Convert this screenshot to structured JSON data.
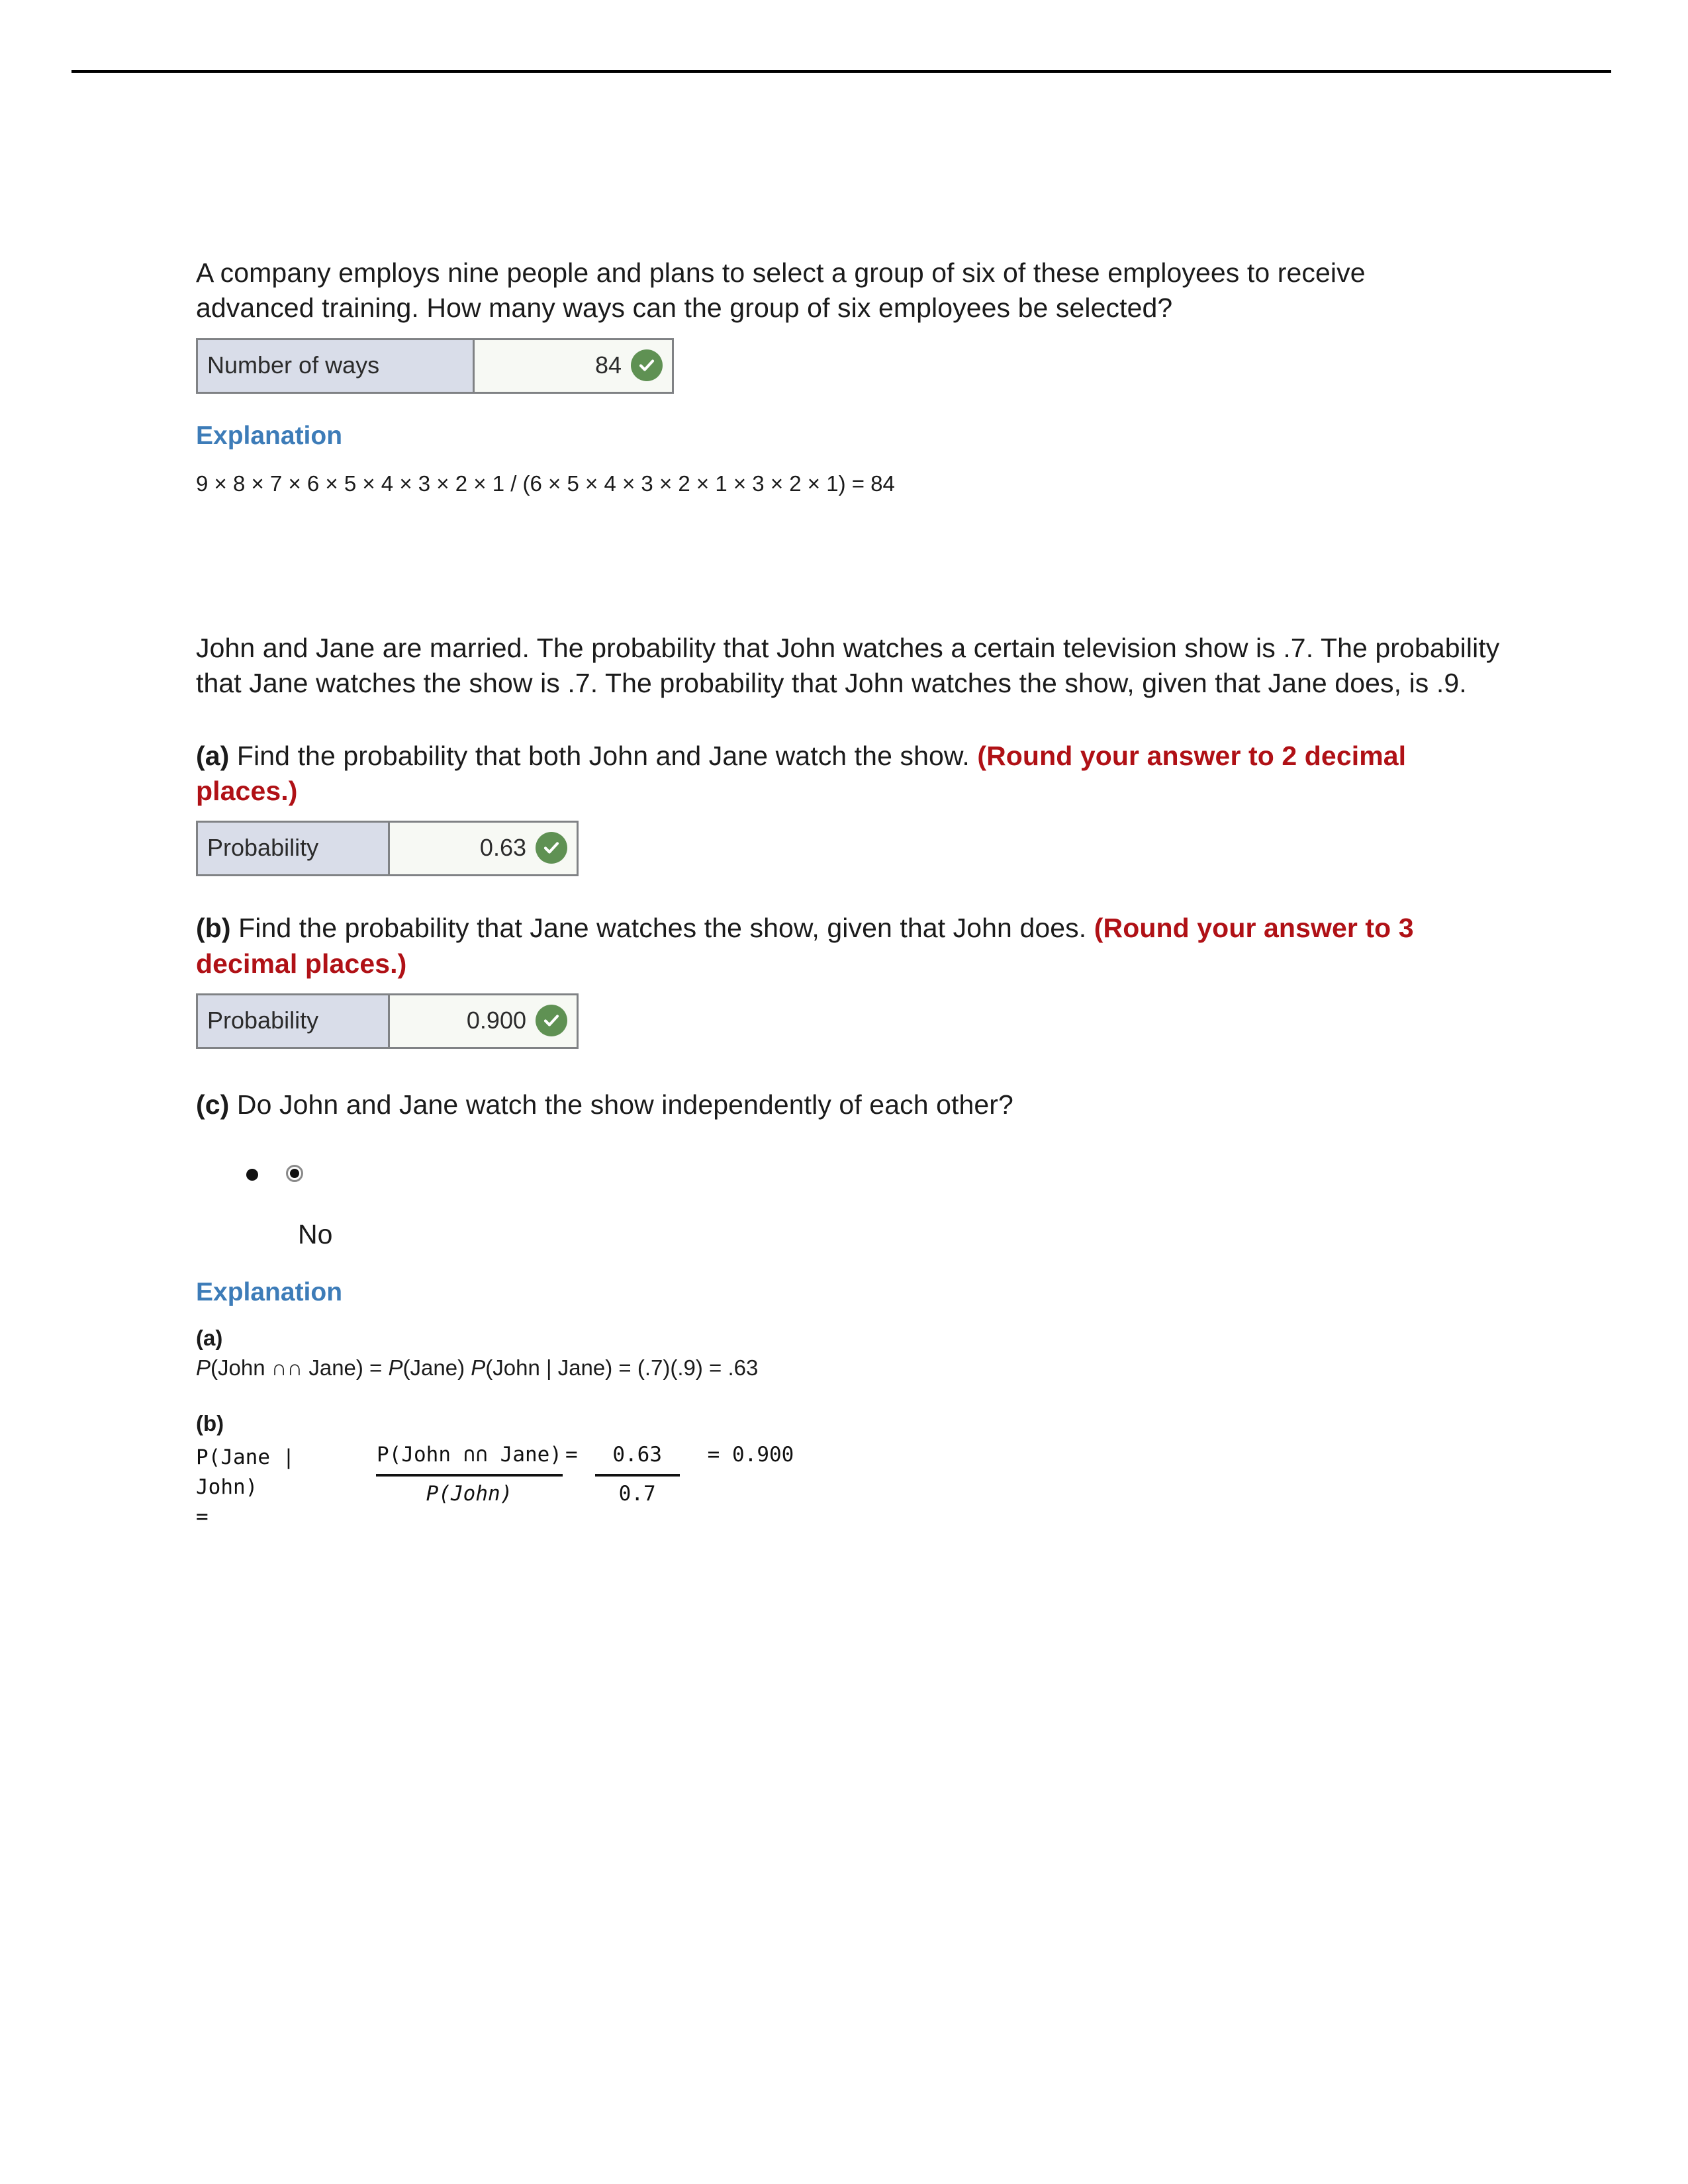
{
  "page": {
    "divider": "horizontal-rule"
  },
  "problem1": {
    "question": "A company employs nine people and plans to select a group of six of these employees to receive advanced training. How many ways can the group of six employees be selected?",
    "answer_box": {
      "label": "Number of ways",
      "value": "84",
      "status_icon": "check-circle-icon",
      "status_color": "#5f9153"
    },
    "explanation": {
      "heading": "Explanation",
      "heading_color": "#3d7cb8",
      "line": "9 × 8 × 7 × 6 × 5 × 4 × 3 × 2 × 1 / (6 × 5 × 4 × 3 × 2 × 1 × 3 × 2 × 1) = 84"
    }
  },
  "problem2": {
    "question": "John and Jane are married. The probability that John watches a certain television show is .7. The probability that Jane watches the show is .7. The probability that John watches the show, given that Jane does, is .9.",
    "parts": {
      "a": {
        "tag": "(a)",
        "text": "Find the probability that both John and Jane watch the show.",
        "rounding_note": "(Round your answer to 2 decimal places.)",
        "rounding_note_color": "#b01116",
        "answer_box": {
          "label": "Probability",
          "value": "0.63",
          "status_icon": "check-circle-icon",
          "status_color": "#5f9153"
        }
      },
      "b": {
        "tag": "(b)",
        "text": "Find the probability that Jane watches the show, given that John does.",
        "rounding_note": "(Round your answer to 3 decimal places.)",
        "rounding_note_color": "#b01116",
        "answer_box": {
          "label": "Probability",
          "value": "0.900",
          "status_icon": "check-circle-icon",
          "status_color": "#5f9153"
        }
      },
      "c": {
        "tag": "(c)",
        "text": "Do John and Jane watch the show independently of each other?",
        "options": [
          {
            "label": "No",
            "selected": true
          }
        ]
      }
    },
    "explanation": {
      "heading": "Explanation",
      "heading_color": "#3d7cb8",
      "part_a_label": "(a)",
      "part_a_line_p1": "P",
      "part_a_line_rest": "(John ∩∩ Jane) = ",
      "part_a_line_p2": "P",
      "part_a_line_rest2": "(Jane) ",
      "part_a_line_p3": "P",
      "part_a_line_rest3": "(John | Jane) = (.7)(.9) = .63",
      "part_b_label": "(b)",
      "part_b_lhs_line1": "P(Jane | John)",
      "part_b_lhs_line2": "=",
      "part_b_frac1_num": "P(John ∩∩ Jane)",
      "part_b_frac1_den": "P(John)",
      "part_b_eq1": "=",
      "part_b_frac2_num": "0.63",
      "part_b_frac2_den": "0.7",
      "part_b_result": "= 0.900"
    }
  }
}
